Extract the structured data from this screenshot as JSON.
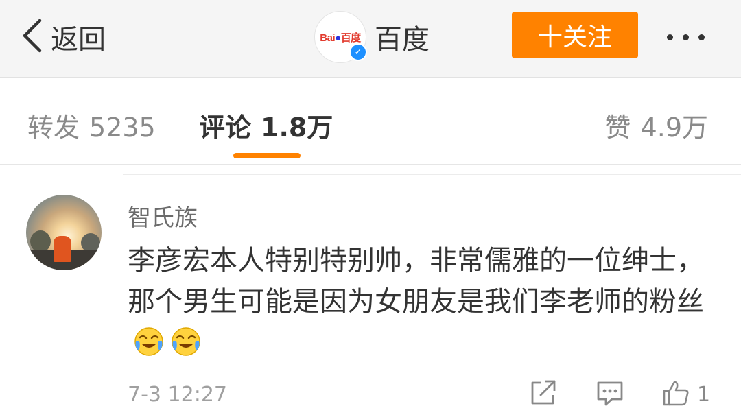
{
  "header": {
    "back_label": "返回",
    "account_logo_text": "Bai百度",
    "account_name": "百度",
    "follow_label": "十关注"
  },
  "tabs": [
    {
      "label": "转发",
      "count": "5235"
    },
    {
      "label": "评论",
      "count": "1.8万",
      "active": true
    },
    {
      "label": "赞",
      "count": "4.9万"
    }
  ],
  "colors": {
    "accent": "#ff8200",
    "verified": "#1e90ff"
  },
  "comment": {
    "user": "智氏族",
    "text": "李彦宏本人特别特别帅，非常儒雅的一位绅士，那个男生可能是因为女朋友是我们李老师的粉丝",
    "emojis": [
      "laugh-cry-emoji",
      "laugh-cry-emoji"
    ],
    "time": "7-3 12:27",
    "like_count": "1"
  }
}
